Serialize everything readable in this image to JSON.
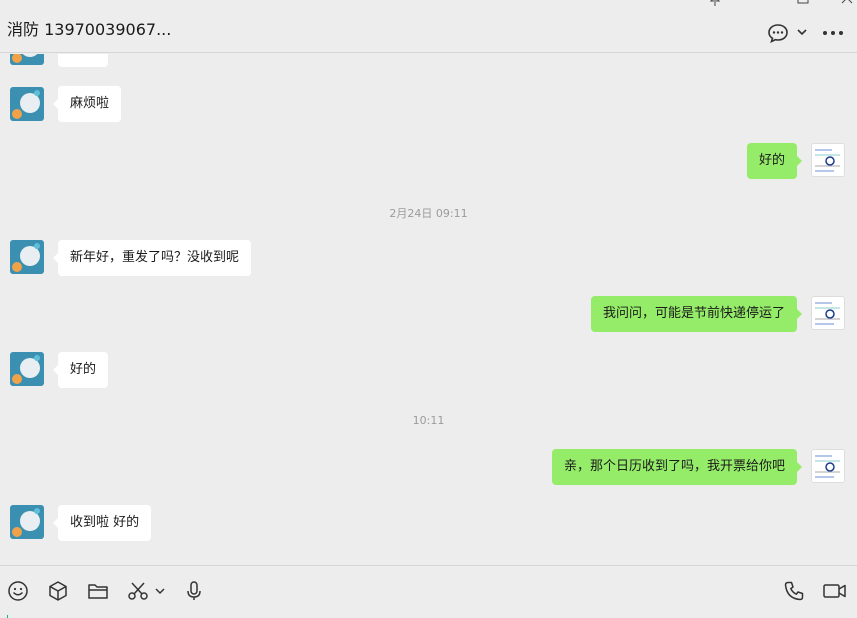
{
  "header": {
    "title": "消防 13970039067..."
  },
  "icons": {
    "chat_menu": "chat-bubble-icon",
    "chevron": "chevron-down-icon",
    "more": "more-horizontal-icon",
    "pin": "pin-icon",
    "minimize": "minimize-icon",
    "maximize": "maximize-icon",
    "close": "close-icon"
  },
  "messages": {
    "m0": "麻烦",
    "m1": "麻烦啦",
    "m2": "好的",
    "ts1": "2月24日 09:11",
    "m3": "新年好，重发了吗？没收到呢",
    "m4": "我问问，可能是节前快递停运了",
    "m5": "好的",
    "ts2": "10:11",
    "m6": "亲，那个日历收到了吗，我开票给你吧",
    "m7": "收到啦 好的"
  },
  "toolbar": {
    "icons": [
      "emoji-icon",
      "sticker-box-icon",
      "folder-icon",
      "scissors-icon",
      "chevron-down-icon",
      "microphone-icon",
      "phone-icon",
      "video-icon"
    ]
  },
  "colors": {
    "background": "#ededed",
    "bubble_out": "#95ec69",
    "bubble_in": "#ffffff",
    "timestamp": "#9b9b9b"
  }
}
